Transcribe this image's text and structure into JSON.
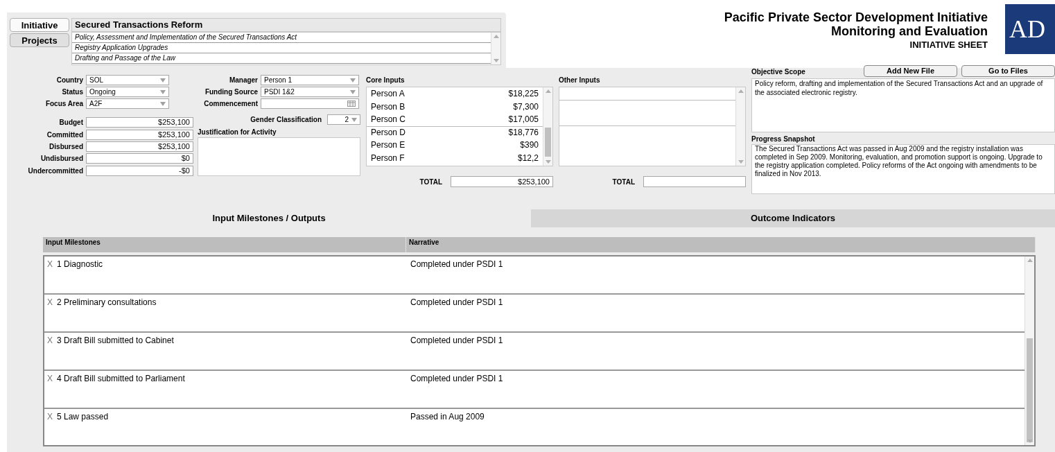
{
  "side_tabs": [
    {
      "label": "Initiative",
      "selected": true
    },
    {
      "label": "Projects",
      "selected": false
    }
  ],
  "initiative_title": "Secured Transactions Reform",
  "projects": [
    "Policy, Assessment and Implementation of the Secured Transactions Act",
    "Registry Application Upgrades",
    "Drafting and Passage of the Law"
  ],
  "header": {
    "title": "Pacific Private Sector Development Initiative",
    "subtitle": "Monitoring and Evaluation",
    "sheet": "INITIATIVE SHEET",
    "logo": "AD"
  },
  "fields_left": [
    {
      "label": "Country",
      "value": "SOL",
      "kind": "dropdown"
    },
    {
      "label": "Status",
      "value": "Ongoing",
      "kind": "dropdown"
    },
    {
      "label": "Focus Area",
      "value": "A2F",
      "kind": "dropdown"
    }
  ],
  "fields_mid": [
    {
      "label": "Manager",
      "value": "Person 1",
      "kind": "dropdown"
    },
    {
      "label": "Funding Source",
      "value": "PSDI 1&2",
      "kind": "dropdown"
    },
    {
      "label": "Commencement",
      "kind": "date"
    }
  ],
  "gender": {
    "label": "Gender Classification",
    "value": "2"
  },
  "amounts": [
    {
      "label": "Budget",
      "value": "$253,100"
    },
    {
      "label": "Committed",
      "value": "$253,100"
    },
    {
      "label": "Disbursed",
      "value": "$253,100"
    },
    {
      "label": "Undisbursed",
      "value": "$0"
    },
    {
      "label": "Undercommitted",
      "value": "-$0"
    }
  ],
  "justification": {
    "label": "Justification for Activity"
  },
  "core_inputs": {
    "label": "Core Inputs",
    "rows": [
      {
        "name": "Person A",
        "amount": "$18,225"
      },
      {
        "name": "Person B",
        "amount": "$7,300"
      },
      {
        "name": "Person C",
        "amount": "$17,005"
      },
      {
        "name": "Person D",
        "amount": "$18,776"
      },
      {
        "name": "Person E",
        "amount": "$390"
      },
      {
        "name": "Person F",
        "amount": "$12,2"
      }
    ],
    "total_label": "TOTAL",
    "total": "$253,100"
  },
  "other_inputs": {
    "label": "Other Inputs",
    "total_label": "TOTAL"
  },
  "buttons": [
    "Add New File",
    "Go to Files"
  ],
  "objective": {
    "label": "Objective Scope",
    "text": "Policy reform, drafting and implementation of the Secured Transactions Act and an upgrade of the associated electronic registry."
  },
  "progress": {
    "label": "Progress Snapshot",
    "text": "The Secured Transactions Act was passed in Aug 2009 and the registry installation was completed in Sep 2009. Monitoring, evaluation, and promotion support is ongoing. Upgrade to the registry application completed. Policy reforms of the Act ongoing with amendments to be finalized in Nov 2013."
  },
  "bottom_tabs": [
    {
      "label": "Input Milestones / Outputs",
      "selected": true
    },
    {
      "label": "Outcome Indicators",
      "selected": false
    }
  ],
  "milestones": {
    "columns": [
      "Input Milestones",
      "Narrative"
    ],
    "rows": [
      {
        "delete": "X",
        "item": "1 Diagnostic",
        "narrative": "Completed under PSDI 1"
      },
      {
        "delete": "X",
        "item": "2 Preliminary consultations",
        "narrative": "Completed under PSDI 1"
      },
      {
        "delete": "X",
        "item": "3 Draft Bill submitted to Cabinet",
        "narrative": "Completed under PSDI 1"
      },
      {
        "delete": "X",
        "item": "4 Draft Bill submitted to Parliament",
        "narrative": "Completed under PSDI 1"
      },
      {
        "delete": "X",
        "item": "5 Law passed",
        "narrative": "Passed in Aug 2009"
      }
    ]
  }
}
